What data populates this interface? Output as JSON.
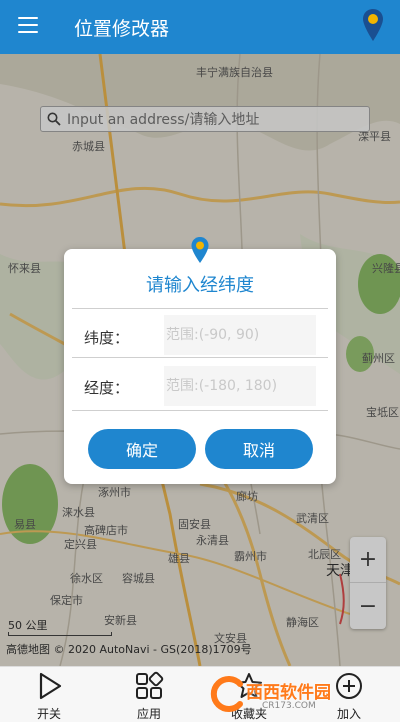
{
  "app": {
    "title": "位置修改器"
  },
  "search": {
    "placeholder": "Input an address/请输入地址"
  },
  "map": {
    "labels": [
      {
        "text": "丰宁满族自治县",
        "name": "label-fengning"
      },
      {
        "text": "滦平县",
        "name": "label-luanping"
      },
      {
        "text": "赤城县",
        "name": "label-chicheng"
      },
      {
        "text": "怀来县",
        "name": "label-huailai"
      },
      {
        "text": "兴隆县",
        "name": "label-xinglong"
      },
      {
        "text": "蓟州区",
        "name": "label-jizhou"
      },
      {
        "text": "宝坻区",
        "name": "label-baodi"
      },
      {
        "text": "涿州市",
        "name": "label-zhuozhou"
      },
      {
        "text": "廊坊",
        "name": "label-langfang"
      },
      {
        "text": "涞水县",
        "name": "label-laishui"
      },
      {
        "text": "易县",
        "name": "label-yixian"
      },
      {
        "text": "高碑店市",
        "name": "label-gaobeidian"
      },
      {
        "text": "定兴县",
        "name": "label-dingxing"
      },
      {
        "text": "固安县",
        "name": "label-guan"
      },
      {
        "text": "永清县",
        "name": "label-yongqing"
      },
      {
        "text": "武清区",
        "name": "label-wuqing"
      },
      {
        "text": "霸州市",
        "name": "label-bazhou"
      },
      {
        "text": "北辰区",
        "name": "label-beichen"
      },
      {
        "text": "天津",
        "name": "label-tianjin"
      },
      {
        "text": "雄县",
        "name": "label-xiongxian"
      },
      {
        "text": "徐水区",
        "name": "label-xushui"
      },
      {
        "text": "容城县",
        "name": "label-rongcheng"
      },
      {
        "text": "保定市",
        "name": "label-baoding"
      },
      {
        "text": "安新县",
        "name": "label-anxin"
      },
      {
        "text": "文安县",
        "name": "label-wenan"
      },
      {
        "text": "静海区",
        "name": "label-jinghai"
      }
    ],
    "scale": "50 公里",
    "copyright": "高德地图 © 2020 AutoNavi - GS(2018)1709号"
  },
  "dialog": {
    "title": "请输入经纬度",
    "lat_label": "纬度：",
    "lat_placeholder": "范围:(-90, 90)",
    "lng_label": "经度：",
    "lng_placeholder": "范围:(-180, 180)",
    "confirm": "确定",
    "cancel": "取消"
  },
  "zoom": {
    "in": "+",
    "out": "−"
  },
  "bottom_nav": [
    {
      "label": "开关",
      "icon": "play-icon"
    },
    {
      "label": "应用",
      "icon": "apps-icon"
    },
    {
      "label": "收藏夹",
      "icon": "favorites-icon"
    },
    {
      "label": "加入",
      "icon": "join-icon"
    }
  ],
  "watermark": {
    "text": "西西软件园",
    "sub": "CR173.COM"
  },
  "colors": {
    "primary": "#1f86cf",
    "overlay": "rgba(0,0,0,0.22)"
  }
}
